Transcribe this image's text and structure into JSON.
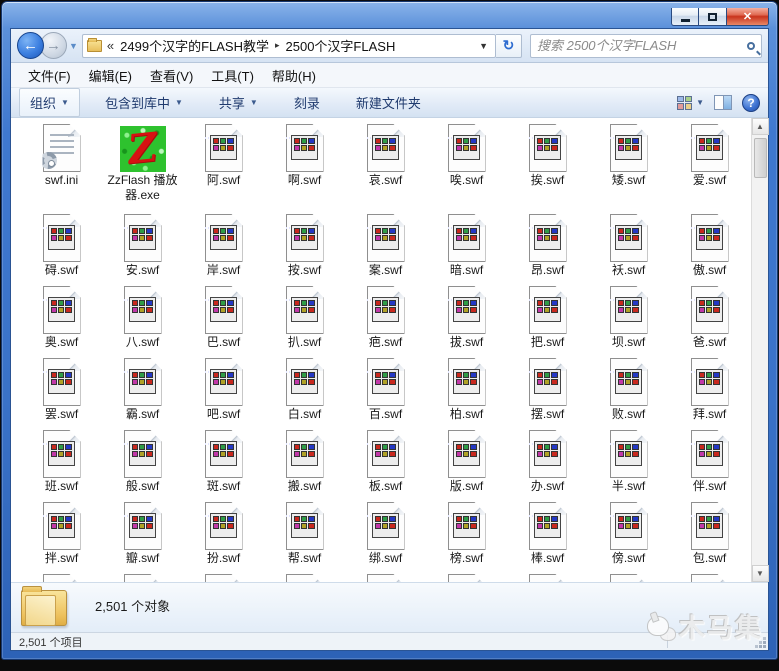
{
  "navigation": {
    "breadcrumb_overflow": "«",
    "breadcrumbs": [
      "2499个汉字的FLASH教学",
      "2500个汉字FLASH"
    ],
    "crumb_separator": "▸",
    "address_dropdown": "▼",
    "refresh_glyph": "↻",
    "search_placeholder": "搜索 2500个汉字FLASH"
  },
  "menu_bar": {
    "items": [
      "文件(F)",
      "编辑(E)",
      "查看(V)",
      "工具(T)",
      "帮助(H)"
    ]
  },
  "toolbar": {
    "items": [
      {
        "label": "组织",
        "dropdown": true
      },
      {
        "label": "包含到库中",
        "dropdown": true
      },
      {
        "label": "共享",
        "dropdown": true
      },
      {
        "label": "刻录",
        "dropdown": false
      },
      {
        "label": "新建文件夹",
        "dropdown": false
      }
    ],
    "help_glyph": "?"
  },
  "files": {
    "rows": [
      [
        {
          "name": "swf.ini",
          "icon": "ini"
        },
        {
          "name": "ZzFlash 播放器.exe",
          "icon": "exe"
        },
        {
          "name": "阿.swf",
          "icon": "swf"
        },
        {
          "name": "啊.swf",
          "icon": "swf"
        },
        {
          "name": "哀.swf",
          "icon": "swf"
        },
        {
          "name": "唉.swf",
          "icon": "swf"
        },
        {
          "name": "挨.swf",
          "icon": "swf"
        },
        {
          "name": "矮.swf",
          "icon": "swf"
        },
        {
          "name": "爱.swf",
          "icon": "swf"
        }
      ],
      [
        {
          "name": "碍.swf",
          "icon": "swf"
        },
        {
          "name": "安.swf",
          "icon": "swf"
        },
        {
          "name": "岸.swf",
          "icon": "swf"
        },
        {
          "name": "按.swf",
          "icon": "swf"
        },
        {
          "name": "案.swf",
          "icon": "swf"
        },
        {
          "name": "暗.swf",
          "icon": "swf"
        },
        {
          "name": "昂.swf",
          "icon": "swf"
        },
        {
          "name": "袄.swf",
          "icon": "swf"
        },
        {
          "name": "傲.swf",
          "icon": "swf"
        }
      ],
      [
        {
          "name": "奥.swf",
          "icon": "swf"
        },
        {
          "name": "八.swf",
          "icon": "swf"
        },
        {
          "name": "巴.swf",
          "icon": "swf"
        },
        {
          "name": "扒.swf",
          "icon": "swf"
        },
        {
          "name": "疤.swf",
          "icon": "swf"
        },
        {
          "name": "拔.swf",
          "icon": "swf"
        },
        {
          "name": "把.swf",
          "icon": "swf"
        },
        {
          "name": "坝.swf",
          "icon": "swf"
        },
        {
          "name": "爸.swf",
          "icon": "swf"
        }
      ],
      [
        {
          "name": "罢.swf",
          "icon": "swf"
        },
        {
          "name": "霸.swf",
          "icon": "swf"
        },
        {
          "name": "吧.swf",
          "icon": "swf"
        },
        {
          "name": "白.swf",
          "icon": "swf"
        },
        {
          "name": "百.swf",
          "icon": "swf"
        },
        {
          "name": "柏.swf",
          "icon": "swf"
        },
        {
          "name": "摆.swf",
          "icon": "swf"
        },
        {
          "name": "败.swf",
          "icon": "swf"
        },
        {
          "name": "拜.swf",
          "icon": "swf"
        }
      ],
      [
        {
          "name": "班.swf",
          "icon": "swf"
        },
        {
          "name": "般.swf",
          "icon": "swf"
        },
        {
          "name": "斑.swf",
          "icon": "swf"
        },
        {
          "name": "搬.swf",
          "icon": "swf"
        },
        {
          "name": "板.swf",
          "icon": "swf"
        },
        {
          "name": "版.swf",
          "icon": "swf"
        },
        {
          "name": "办.swf",
          "icon": "swf"
        },
        {
          "name": "半.swf",
          "icon": "swf"
        },
        {
          "name": "伴.swf",
          "icon": "swf"
        }
      ],
      [
        {
          "name": "拌.swf",
          "icon": "swf"
        },
        {
          "name": "瓣.swf",
          "icon": "swf"
        },
        {
          "name": "扮.swf",
          "icon": "swf"
        },
        {
          "name": "帮.swf",
          "icon": "swf"
        },
        {
          "name": "绑.swf",
          "icon": "swf"
        },
        {
          "name": "榜.swf",
          "icon": "swf"
        },
        {
          "name": "棒.swf",
          "icon": "swf"
        },
        {
          "name": "傍.swf",
          "icon": "swf"
        },
        {
          "name": "包.swf",
          "icon": "swf"
        }
      ]
    ],
    "partial_next_row_items": 9,
    "exe_letter": "Z"
  },
  "details_pane": {
    "count_text": "2,501 个对象"
  },
  "status_bar": {
    "count_text": "2,501 个项目"
  },
  "watermark": {
    "text": "木马集"
  }
}
